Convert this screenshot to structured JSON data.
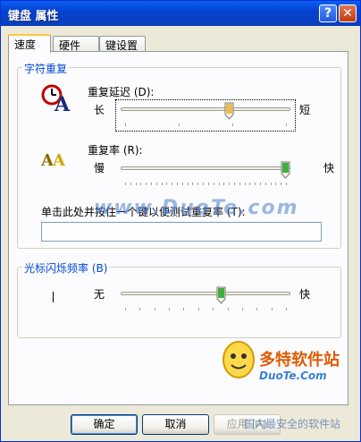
{
  "window": {
    "title": "键盘 属性",
    "help_glyph": "?",
    "close_glyph": "✕"
  },
  "tabs": [
    {
      "label": "速度",
      "active": true
    },
    {
      "label": "硬件"
    },
    {
      "label": "键设置"
    }
  ],
  "char_repeat": {
    "legend": "字符重复",
    "delay": {
      "label": "重复延迟 (D):",
      "left": "长",
      "right": "短",
      "value_fraction": 0.65
    },
    "rate": {
      "label": "重复率 (R):",
      "left": "慢",
      "right": "快",
      "value_fraction": 1.0
    },
    "test_label": "单击此处并按住一个键以便测试重复率 (T):",
    "test_value": ""
  },
  "cursor_blink": {
    "legend": "光标闪烁频率 (B)",
    "left": "无",
    "right": "快",
    "value_fraction": 0.6
  },
  "buttons": {
    "ok": "确定",
    "cancel": "取消",
    "apply": "应用 (A)"
  },
  "watermark": {
    "main": "www.DuoTe.com",
    "brand": "多特软件站",
    "sub": "DuoTe.Com",
    "tagline": "国内最安全的软件站"
  },
  "colors": {
    "legend_text": "#0046d5",
    "title_bar": "#0543d1",
    "thumb_green": "#21a121"
  }
}
